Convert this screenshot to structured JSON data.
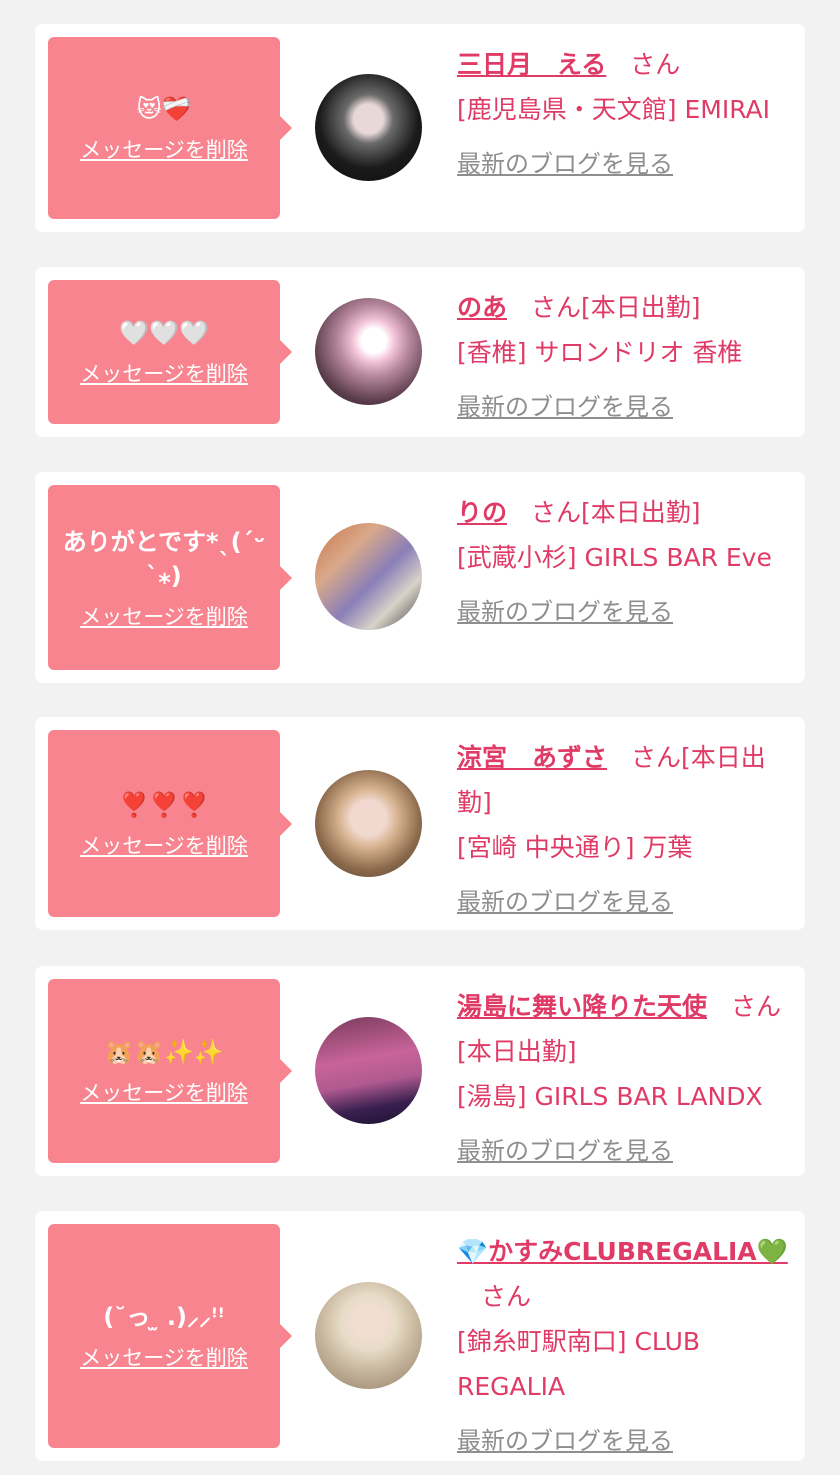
{
  "delete_label": "メッセージを削除",
  "blog_label": "最新のブログを見る",
  "colors": {
    "bubble": "#f8848f",
    "accent": "#e03a66",
    "link_gray": "#8e8e8e"
  },
  "items": [
    {
      "message": "😻❤️‍🩹",
      "name": "三日月　える",
      "suffix": "さん",
      "details": "[鹿児島県・天文館] EMIRAI",
      "avatar_icon": "dark-hair-portrait"
    },
    {
      "message": "🤍🤍🤍",
      "name": "のあ",
      "suffix": "さん[本日出勤]",
      "details": "[香椎] サロンドリオ 香椎",
      "avatar_icon": "bunny-plush-photo"
    },
    {
      "message": "ありがとです*ˎ(ˊᵕˋ⁎)",
      "name": "りの",
      "suffix": "さん[本日出勤]",
      "details": "[武蔵小杉] GIRLS BAR Eve",
      "avatar_icon": "anime-poster-photo"
    },
    {
      "message": "❣️❣️❣️",
      "name": "涼宮　あずさ",
      "suffix": "さん[本日出勤]",
      "details": "[宮崎 中央通り] 万葉",
      "avatar_icon": "blonde-portrait"
    },
    {
      "message": "🐹🐹✨✨",
      "name": "湯島に舞い降りた天使",
      "suffix": "さん[本日出勤]",
      "details": "[湯島] GIRLS BAR LANDX",
      "avatar_icon": "pink-light-photo"
    },
    {
      "message": "(˘っ ̫ .)⸝⸝ꜝꜝ",
      "name": "💎かすみCLUBREGALIA💚",
      "suffix": "さん",
      "details": "[錦糸町駅南口] CLUB REGALIA",
      "avatar_icon": "white-dress-portrait"
    }
  ]
}
